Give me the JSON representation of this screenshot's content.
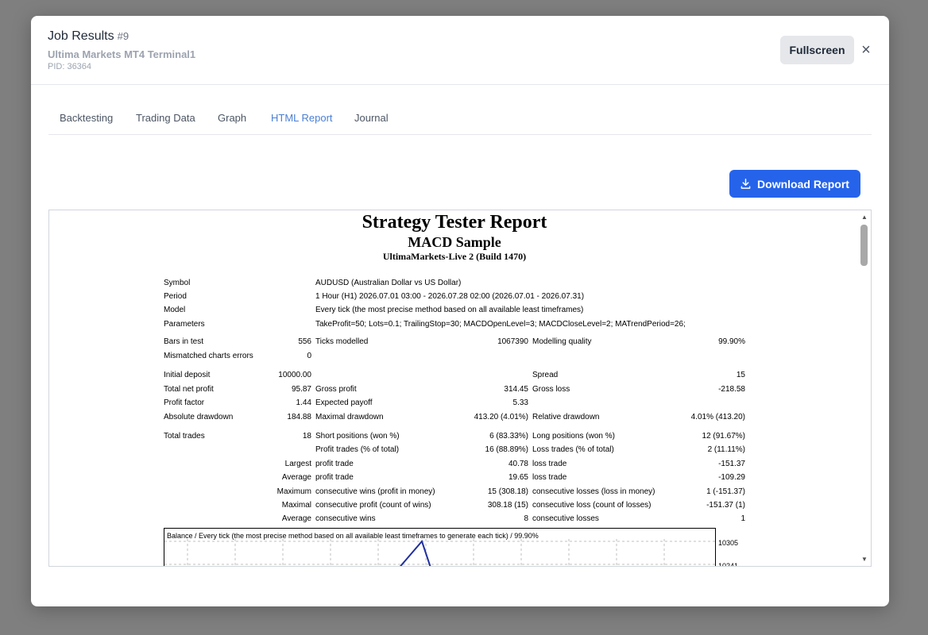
{
  "header": {
    "title": "Job Results",
    "job_number": "#9",
    "subtitle": "Ultima Markets MT4 Terminal1",
    "pid": "PID: 36364",
    "fullscreen_label": "Fullscreen",
    "close_symbol": "×"
  },
  "tabs": [
    {
      "label": "Backtesting"
    },
    {
      "label": "Trading Data"
    },
    {
      "label": "Graph"
    },
    {
      "label": "HTML Report",
      "active": true
    },
    {
      "label": "Journal"
    }
  ],
  "download_label": "Download Report",
  "colors": {
    "accent": "#2563eb",
    "active_tab": "#4a7fd4"
  },
  "report": {
    "title": "Strategy Tester Report",
    "expert": "MACD Sample",
    "server": "UltimaMarkets-Live 2 (Build 1470)",
    "symbol_label": "Symbol",
    "symbol_value": "AUDUSD (Australian Dollar vs US Dollar)",
    "period_label": "Period",
    "period_value": "1 Hour (H1) 2026.07.01 03:00 - 2026.07.28 02:00 (2026.07.01 - 2026.07.31)",
    "model_label": "Model",
    "model_value": "Every tick (the most precise method based on all available least timeframes)",
    "parameters_label": "Parameters",
    "parameters_value": "TakeProfit=50; Lots=0.1; TrailingStop=30; MACDOpenLevel=3; MACDCloseLevel=2; MATrendPeriod=26;",
    "rows": [
      {
        "l1": "Bars in test",
        "v1": "556",
        "l2": "Ticks modelled",
        "v2": "1067390",
        "l3": "Modelling quality",
        "v3": "99.90%"
      },
      {
        "l1": "Mismatched charts errors",
        "v1": "0",
        "l2": "",
        "v2": "",
        "l3": "",
        "v3": ""
      },
      {
        "l1": "Initial deposit",
        "v1": "10000.00",
        "l2": "",
        "v2": "",
        "l3": "Spread",
        "v3": "15"
      },
      {
        "l1": "Total net profit",
        "v1": "95.87",
        "l2": "Gross profit",
        "v2": "314.45",
        "l3": "Gross loss",
        "v3": "-218.58"
      },
      {
        "l1": "Profit factor",
        "v1": "1.44",
        "l2": "Expected payoff",
        "v2": "5.33",
        "l3": "",
        "v3": ""
      },
      {
        "l1": "Absolute drawdown",
        "v1": "184.88",
        "l2": "Maximal drawdown",
        "v2": "413.20 (4.01%)",
        "l3": "Relative drawdown",
        "v3": "4.01% (413.20)"
      },
      {
        "l1": "Total trades",
        "v1": "18",
        "l2": "Short positions (won %)",
        "v2": "6 (83.33%)",
        "l3": "Long positions (won %)",
        "v3": "12 (91.67%)"
      },
      {
        "l1": "",
        "v1": "",
        "l2": "Profit trades (% of total)",
        "v2": "16 (88.89%)",
        "l3": "Loss trades (% of total)",
        "v3": "2 (11.11%)"
      },
      {
        "l1": "",
        "v1": "Largest",
        "l2": "profit trade",
        "v2": "40.78",
        "l3": "loss trade",
        "v3": "-151.37"
      },
      {
        "l1": "",
        "v1": "Average",
        "l2": "profit trade",
        "v2": "19.65",
        "l3": "loss trade",
        "v3": "-109.29"
      },
      {
        "l1": "",
        "v1": "Maximum",
        "l2": "consecutive wins (profit in money)",
        "v2": "15 (308.18)",
        "l3": "consecutive losses (loss in money)",
        "v3": "1 (-151.37)"
      },
      {
        "l1": "",
        "v1": "Maximal",
        "l2": "consecutive profit (count of wins)",
        "v2": "308.18 (15)",
        "l3": "consecutive loss (count of losses)",
        "v3": "-151.37 (1)"
      },
      {
        "l1": "",
        "v1": "Average",
        "l2": "consecutive wins",
        "v2": "8",
        "l3": "consecutive losses",
        "v3": "1"
      }
    ],
    "graph_title": "Balance / Every tick (the most precise method based on all available least timeframes to generate each tick) / 99.90%",
    "graph_axis_labels": [
      "10305",
      "10241"
    ]
  }
}
